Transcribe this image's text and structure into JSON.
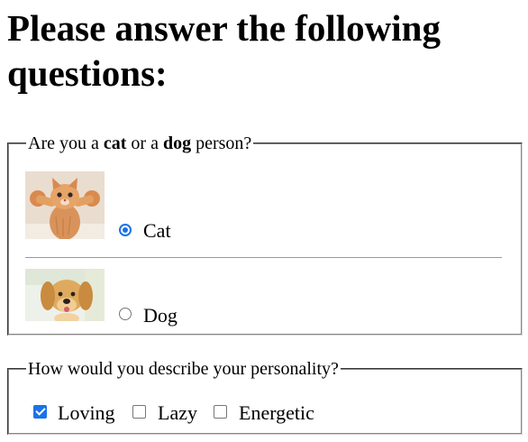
{
  "heading": "Please answer the following questions:",
  "question1": {
    "legend_prefix": "Are you a ",
    "legend_cat": "cat",
    "legend_middle": " or a ",
    "legend_dog": "dog",
    "legend_suffix": " person?",
    "options": [
      {
        "label": "Cat",
        "selected": true,
        "image": "kitten-photo"
      },
      {
        "label": "Dog",
        "selected": false,
        "image": "puppy-photo"
      }
    ]
  },
  "question2": {
    "legend": "How would you describe your personality?",
    "options": [
      {
        "label": "Loving",
        "checked": true
      },
      {
        "label": "Lazy",
        "checked": false
      },
      {
        "label": "Energetic",
        "checked": false
      }
    ]
  },
  "colors": {
    "accent": "#1a73e8"
  }
}
